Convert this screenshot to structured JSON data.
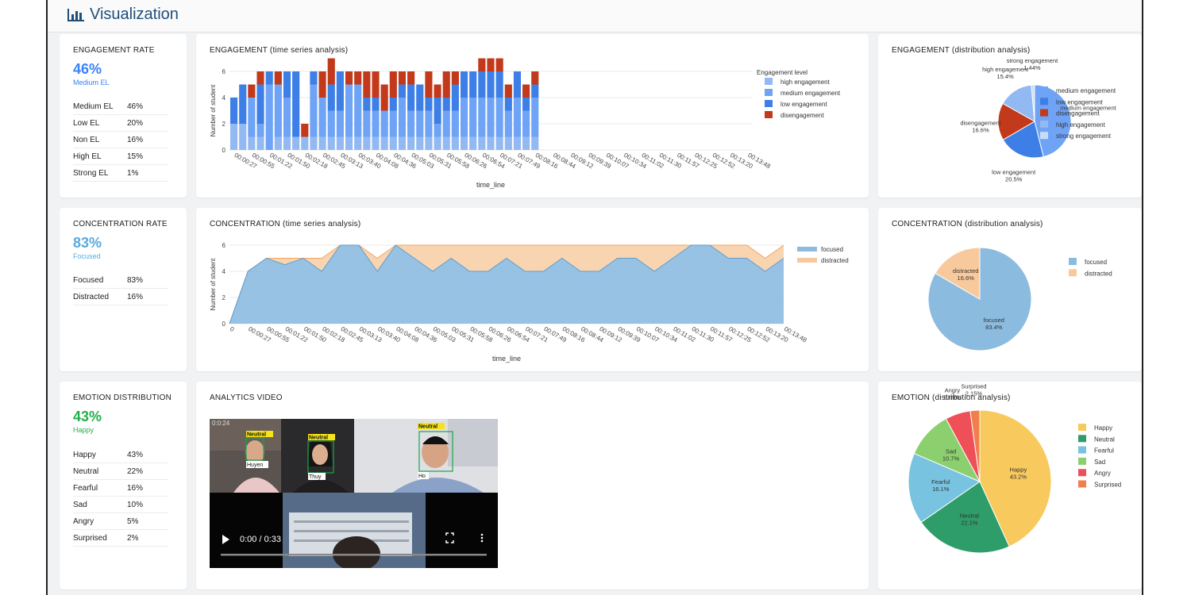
{
  "header": {
    "title": "Visualization",
    "icon": "bar-chart-icon"
  },
  "engagement_rate": {
    "title": "ENGAGEMENT RATE",
    "value": "46%",
    "label": "Medium EL",
    "color": "#3b82f6",
    "rows": [
      {
        "name": "Medium EL",
        "value": "46%"
      },
      {
        "name": "Low EL",
        "value": "20%"
      },
      {
        "name": "Non EL",
        "value": "16%"
      },
      {
        "name": "High EL",
        "value": "15%"
      },
      {
        "name": "Strong EL",
        "value": "1%"
      }
    ]
  },
  "concentration_rate": {
    "title": "CONCENTRATION RATE",
    "value": "83%",
    "label": "Focused",
    "color": "#5aa9e0",
    "rows": [
      {
        "name": "Focused",
        "value": "83%"
      },
      {
        "name": "Distracted",
        "value": "16%"
      }
    ]
  },
  "emotion_distribution": {
    "title": "EMOTION DISTRIBUTION",
    "value": "43%",
    "label": "Happy",
    "color": "#22b04b",
    "rows": [
      {
        "name": "Happy",
        "value": "43%"
      },
      {
        "name": "Neutral",
        "value": "22%"
      },
      {
        "name": "Fearful",
        "value": "16%"
      },
      {
        "name": "Sad",
        "value": "10%"
      },
      {
        "name": "Angry",
        "value": "5%"
      },
      {
        "name": "Surprised",
        "value": "2%"
      }
    ]
  },
  "analytics_video": {
    "title": "ANALYTICS VIDEO",
    "timestamp": "0:0:24",
    "time_display": "0:00 / 0:33",
    "progress": 0.0,
    "faces": [
      {
        "emotion": "Neutral",
        "name": "Huyen"
      },
      {
        "emotion": "Neutral",
        "name": "Thuy"
      },
      {
        "emotion": "Neutral",
        "name": "Ho"
      }
    ]
  },
  "chart_data": [
    {
      "id": "engagement_ts",
      "type": "bar",
      "title": "ENGAGEMENT (time series analysis)",
      "xlabel": "time_line",
      "ylabel": "Number of student",
      "ylim": [
        0,
        6
      ],
      "yticks": [
        0,
        2,
        4,
        6
      ],
      "legend_title": "Engagement level",
      "categories": [
        "00:00:27",
        "",
        "00:00:55",
        "",
        "00:01:22",
        "",
        "00:01:50",
        "",
        "00:02:18",
        "",
        "00:02:45",
        "",
        "00:03:13",
        "",
        "00:03:40",
        "",
        "00:04:08",
        "",
        "00:04:36",
        "",
        "00:05:03",
        "",
        "00:05:31",
        "",
        "00:05:58",
        "",
        "00:06:26",
        "",
        "00:06:54",
        "",
        "00:07:21",
        "",
        "00:07:49",
        "",
        "00:08:16",
        "",
        "00:08:44",
        "",
        "00:09:12",
        "",
        "00:09:39",
        "",
        "00:10:07",
        "",
        "00:10:34",
        "",
        "00:11:02",
        "",
        "00:11:30",
        "",
        "00:11:57",
        "",
        "00:12:25",
        "",
        "00:12:52",
        "",
        "00:13:20",
        "",
        "00:13:48"
      ],
      "series": [
        {
          "name": "high engagement",
          "color": "#93b9f2",
          "values": [
            2,
            2,
            1,
            1,
            0,
            1,
            1,
            1,
            1,
            1,
            1,
            1,
            1,
            1,
            1,
            1,
            1,
            1,
            1,
            1,
            1,
            1,
            1,
            1,
            1,
            1,
            1,
            1,
            1,
            1,
            1,
            1,
            1,
            1,
            1
          ]
        },
        {
          "name": "medium engagement",
          "color": "#6ea3f5",
          "values": [
            0,
            0,
            3,
            1,
            5,
            4,
            3,
            0,
            0,
            4,
            3,
            2,
            2,
            4,
            4,
            2,
            2,
            2,
            2,
            3,
            2,
            2,
            2,
            1,
            2,
            2,
            3,
            3,
            3,
            3,
            3,
            2,
            3,
            2,
            3
          ]
        },
        {
          "name": "low engagement",
          "color": "#3d7fe6",
          "values": [
            2,
            3,
            0,
            3,
            1,
            0,
            2,
            5,
            0,
            1,
            0,
            2,
            3,
            0,
            0,
            1,
            1,
            0,
            1,
            1,
            2,
            2,
            1,
            2,
            1,
            2,
            2,
            2,
            2,
            2,
            2,
            1,
            2,
            1,
            1
          ]
        },
        {
          "name": "disengagement",
          "color": "#c2391b",
          "values": [
            0,
            0,
            1,
            1,
            0,
            1,
            0,
            0,
            1,
            0,
            2,
            2,
            0,
            1,
            1,
            2,
            2,
            2,
            2,
            1,
            1,
            0,
            2,
            1,
            2,
            1,
            0,
            0,
            1,
            1,
            1,
            1,
            0,
            1,
            1
          ]
        }
      ]
    },
    {
      "id": "engagement_pie",
      "type": "pie",
      "title": "ENGAGEMENT (distribution analysis)",
      "labels": [
        "medium engagement",
        "low engagement",
        "disengagement",
        "high engagement",
        "strong engagement"
      ],
      "values": [
        46.1,
        20.5,
        16.6,
        15.4,
        1.44
      ],
      "value_labels": [
        "",
        "20.5%",
        "16.6%",
        "15.4%",
        "1.44%"
      ],
      "colors": [
        "#6ea3f5",
        "#3d7fe6",
        "#c2391b",
        "#93b9f2",
        "#c9dcf7"
      ]
    },
    {
      "id": "concentration_ts",
      "type": "area",
      "title": "CONCENTRATION (time series analysis)",
      "xlabel": "time_line",
      "ylabel": "Number of student",
      "ylim": [
        0,
        6
      ],
      "yticks": [
        0,
        2,
        4,
        6
      ],
      "categories": [
        "0",
        "00:00:27",
        "00:00:55",
        "00:01:22",
        "00:01:50",
        "00:02:18",
        "00:02:45",
        "00:03:13",
        "00:03:40",
        "00:04:08",
        "00:04:36",
        "00:05:03",
        "00:05:31",
        "00:05:58",
        "00:06:26",
        "00:06:54",
        "00:07:21",
        "00:07:49",
        "00:08:16",
        "00:08:44",
        "00:09:12",
        "00:09:39",
        "00:10:07",
        "00:10:34",
        "00:11:02",
        "00:11:30",
        "00:11:57",
        "00:12:25",
        "00:12:52",
        "00:13:20",
        "00:13:48"
      ],
      "series": [
        {
          "name": "focused",
          "color": "#8cbbe0",
          "values": [
            0,
            4,
            5,
            4.5,
            5,
            4,
            6,
            6,
            4,
            6,
            5,
            4,
            5,
            4,
            4,
            5,
            4,
            4,
            5,
            4,
            4,
            5,
            5,
            4,
            5,
            6,
            6,
            5,
            5,
            4,
            5
          ]
        },
        {
          "name": "distracted",
          "color": "#f8c99c",
          "values": [
            0,
            0,
            0,
            0.5,
            0,
            1,
            0,
            0,
            1,
            0,
            1,
            2,
            1,
            2,
            2,
            1,
            2,
            2,
            1,
            2,
            2,
            1,
            1,
            2,
            1,
            0,
            0,
            1,
            1,
            1,
            1
          ]
        }
      ]
    },
    {
      "id": "concentration_pie",
      "type": "pie",
      "title": "CONCENTRATION (distribution analysis)",
      "labels": [
        "focused",
        "distracted"
      ],
      "values": [
        83.4,
        16.6
      ],
      "value_labels": [
        "83.4%",
        "16.6%"
      ],
      "colors": [
        "#8cbbe0",
        "#f8c99c"
      ]
    },
    {
      "id": "emotion_pie",
      "type": "pie",
      "title": "EMOTION (distribution analysis)",
      "labels": [
        "Happy",
        "Neutral",
        "Fearful",
        "Sad",
        "Angry",
        "Surprised"
      ],
      "values": [
        43.2,
        22.1,
        16.1,
        10.7,
        5.69,
        2.15
      ],
      "value_labels": [
        "43.2%",
        "22.1%",
        "16.1%",
        "10.7%",
        "5.69%",
        "2.15%"
      ],
      "colors": [
        "#f8c95c",
        "#2e9d6a",
        "#78c3e0",
        "#8ccf6e",
        "#ef4f56",
        "#f07f4b"
      ]
    }
  ]
}
